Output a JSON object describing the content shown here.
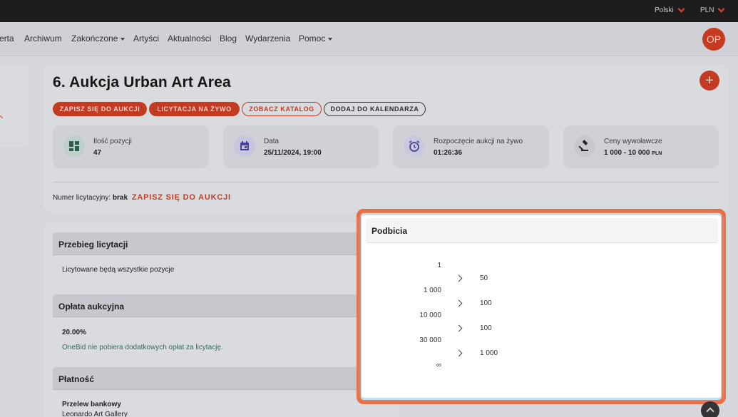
{
  "topbar": {
    "language": "Polski",
    "currency": "PLN"
  },
  "nav": {
    "items": [
      "erta",
      "Archiwum",
      "Zakończone",
      "Artyści",
      "Aktualności",
      "Blog",
      "Wydarzenia",
      "Pomoc"
    ],
    "avatar_initials": "OP"
  },
  "auction": {
    "title": "6. Aukcja Urban Art Area",
    "buttons": {
      "register": "ZAPISZ SIĘ DO AUKCJI",
      "live": "LICYTACJA NA ŻYWO",
      "catalog": "ZOBACZ KATALOG",
      "calendar": "DODAJ DO KALENDARZA"
    },
    "stats": {
      "items_label": "Ilość pozycji",
      "items_value": "47",
      "date_label": "Data",
      "date_value": "25/11/2024, 19:00",
      "start_label": "Rozpoczęcie aukcji na żywo",
      "start_value": "01:26:36",
      "prices_label": "Ceny wywoławcze",
      "prices_value": "1 000 - 10 000",
      "prices_currency": "PLN"
    },
    "bid_number_label": "Numer licytacyjny:",
    "bid_number_value": "brak",
    "bid_number_link": "ZAPISZ SIĘ DO AUKCJI"
  },
  "details": {
    "course_title": "Przebieg licytacji",
    "course_text": "Licytowane będą wszystkie pozycje",
    "fee_title": "Opłata aukcyjna",
    "fee_value": "20.00%",
    "fee_note": "OneBid nie pobiera dodatkowych opłat za licytację.",
    "payment_title": "Płatność",
    "payment_method": "Przelew bankowy",
    "payment_recipient": "Leonardo Art Gallery"
  },
  "modal": {
    "title": "Podbicia",
    "thresholds": [
      "1",
      "1 000",
      "10 000",
      "30 000",
      "∞"
    ],
    "increments": [
      "50",
      "100",
      "100",
      "1 000"
    ]
  },
  "colors": {
    "accent": "#c23b22",
    "highlight_border": "#ec6a3d",
    "topbar": "#1d1d1d"
  }
}
